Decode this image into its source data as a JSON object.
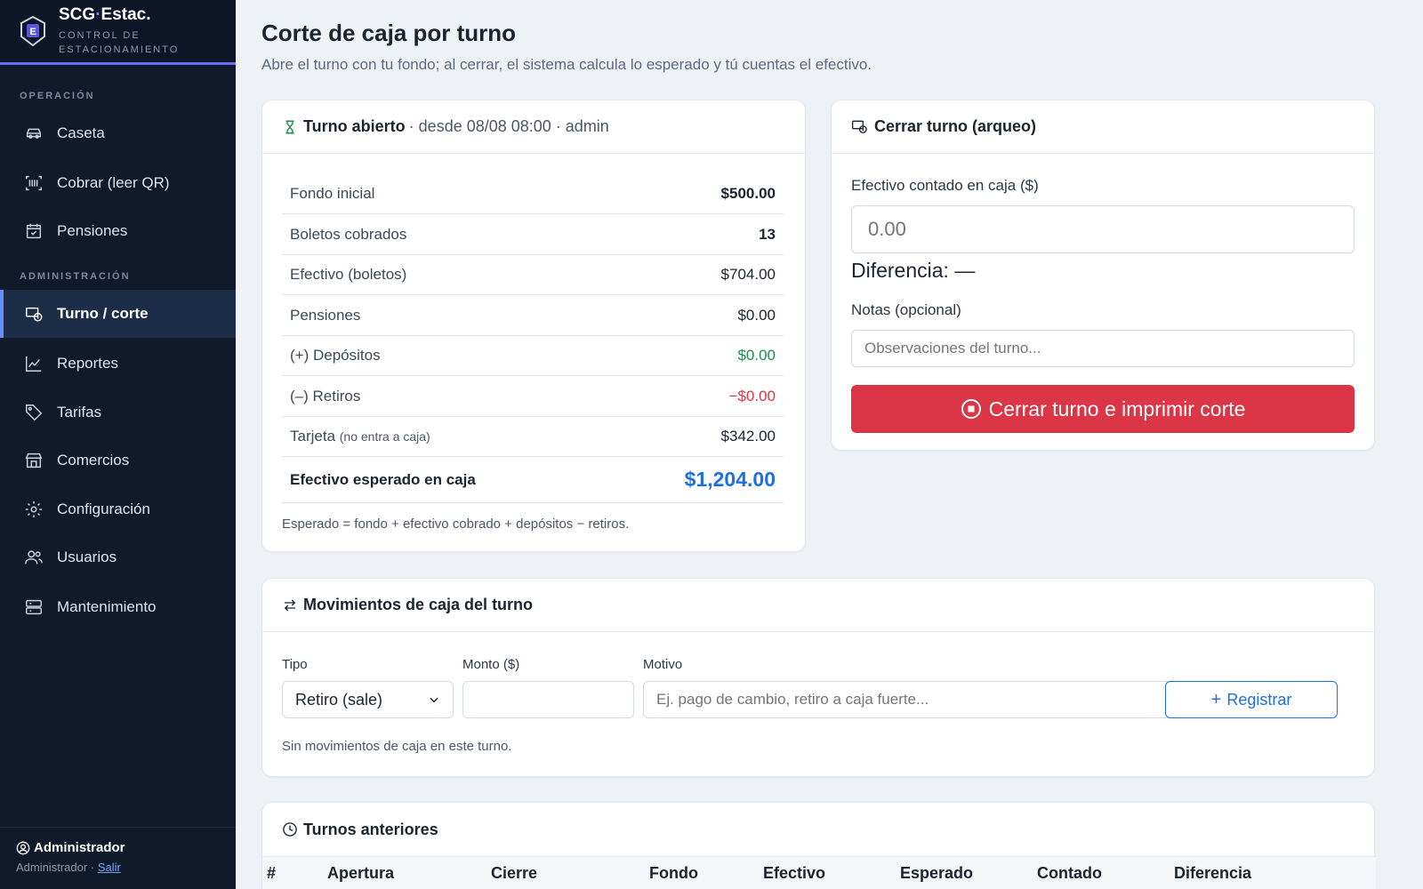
{
  "brand": {
    "title_left": "SCG",
    "title_dot": "·",
    "title_right": "Estac.",
    "subtitle_line1": "CONTROL DE",
    "subtitle_line2": "ESTACIONAMIENTO",
    "logo_letter": "E"
  },
  "sidebar": {
    "section_operacion": "OPERACIÓN",
    "section_admin": "ADMINISTRACIÓN",
    "items": [
      {
        "label": "Caseta",
        "icon": "car-icon"
      },
      {
        "label": "Cobrar (leer QR)",
        "icon": "barcode-icon"
      },
      {
        "label": "Pensiones",
        "icon": "calendar-check-icon"
      },
      {
        "label": "Turno / corte",
        "icon": "cash-register-icon",
        "active": true
      },
      {
        "label": "Reportes",
        "icon": "line-chart-icon"
      },
      {
        "label": "Tarifas",
        "icon": "tag-icon"
      },
      {
        "label": "Comercios",
        "icon": "store-icon"
      },
      {
        "label": "Configuración",
        "icon": "gear-icon"
      },
      {
        "label": "Usuarios",
        "icon": "users-icon"
      },
      {
        "label": "Mantenimiento",
        "icon": "server-icon"
      }
    ],
    "user": {
      "name": "Administrador",
      "role": "Administrador",
      "separator": "·",
      "logout": "Salir"
    }
  },
  "page": {
    "title": "Corte de caja por turno",
    "subtitle": "Abre el turno con tu fondo; al cerrar, el sistema calcula lo esperado y tú cuentas el efectivo."
  },
  "shift": {
    "header_bold": "Turno abierto",
    "header_rest": "· desde 08/08 08:00 · admin",
    "rows": [
      {
        "label": "Fondo inicial",
        "value": "$500.00"
      },
      {
        "label": "Boletos cobrados",
        "value": "13"
      },
      {
        "label": "Efectivo (boletos)",
        "value": "$704.00"
      },
      {
        "label": "Pensiones",
        "value": "$0.00"
      },
      {
        "label": "(+) Depósitos",
        "value": "$0.00"
      },
      {
        "label": "(–) Retiros",
        "value": "−$0.00"
      },
      {
        "label": "Tarjeta",
        "label_note": "(no entra a caja)",
        "value": "$342.00"
      }
    ],
    "total_label": "Efectivo esperado en caja",
    "total_value": "$1,204.00",
    "formula": "Esperado = fondo + efectivo cobrado + depósitos − retiros."
  },
  "close": {
    "header": "Cerrar turno (arqueo)",
    "counted_label": "Efectivo contado en caja ($)",
    "counted_placeholder": "0.00",
    "difference": "Diferencia: —",
    "notes_label": "Notas (opcional)",
    "notes_placeholder": "Observaciones del turno...",
    "button": "Cerrar turno e imprimir corte"
  },
  "movements": {
    "header": "Movimientos de caja del turno",
    "type_label": "Tipo",
    "type_value": "Retiro (sale)",
    "amount_label": "Monto ($)",
    "amount_value": "",
    "reason_label": "Motivo",
    "reason_placeholder": "Ej. pago de cambio, retiro a caja fuerte...",
    "register_button": "Registrar",
    "empty": "Sin movimientos de caja en este turno."
  },
  "history": {
    "header": "Turnos anteriores",
    "columns": [
      "#",
      "Apertura",
      "Cierre",
      "Fondo",
      "Efectivo",
      "Esperado",
      "Contado",
      "Diferencia"
    ]
  },
  "colors": {
    "sidebar_bg": "#0f1a2b",
    "accent": "#6b8cff",
    "primary": "#1f6fe0",
    "danger": "#dc3545",
    "positive": "#1f8a4c",
    "negative": "#d33a4a"
  }
}
